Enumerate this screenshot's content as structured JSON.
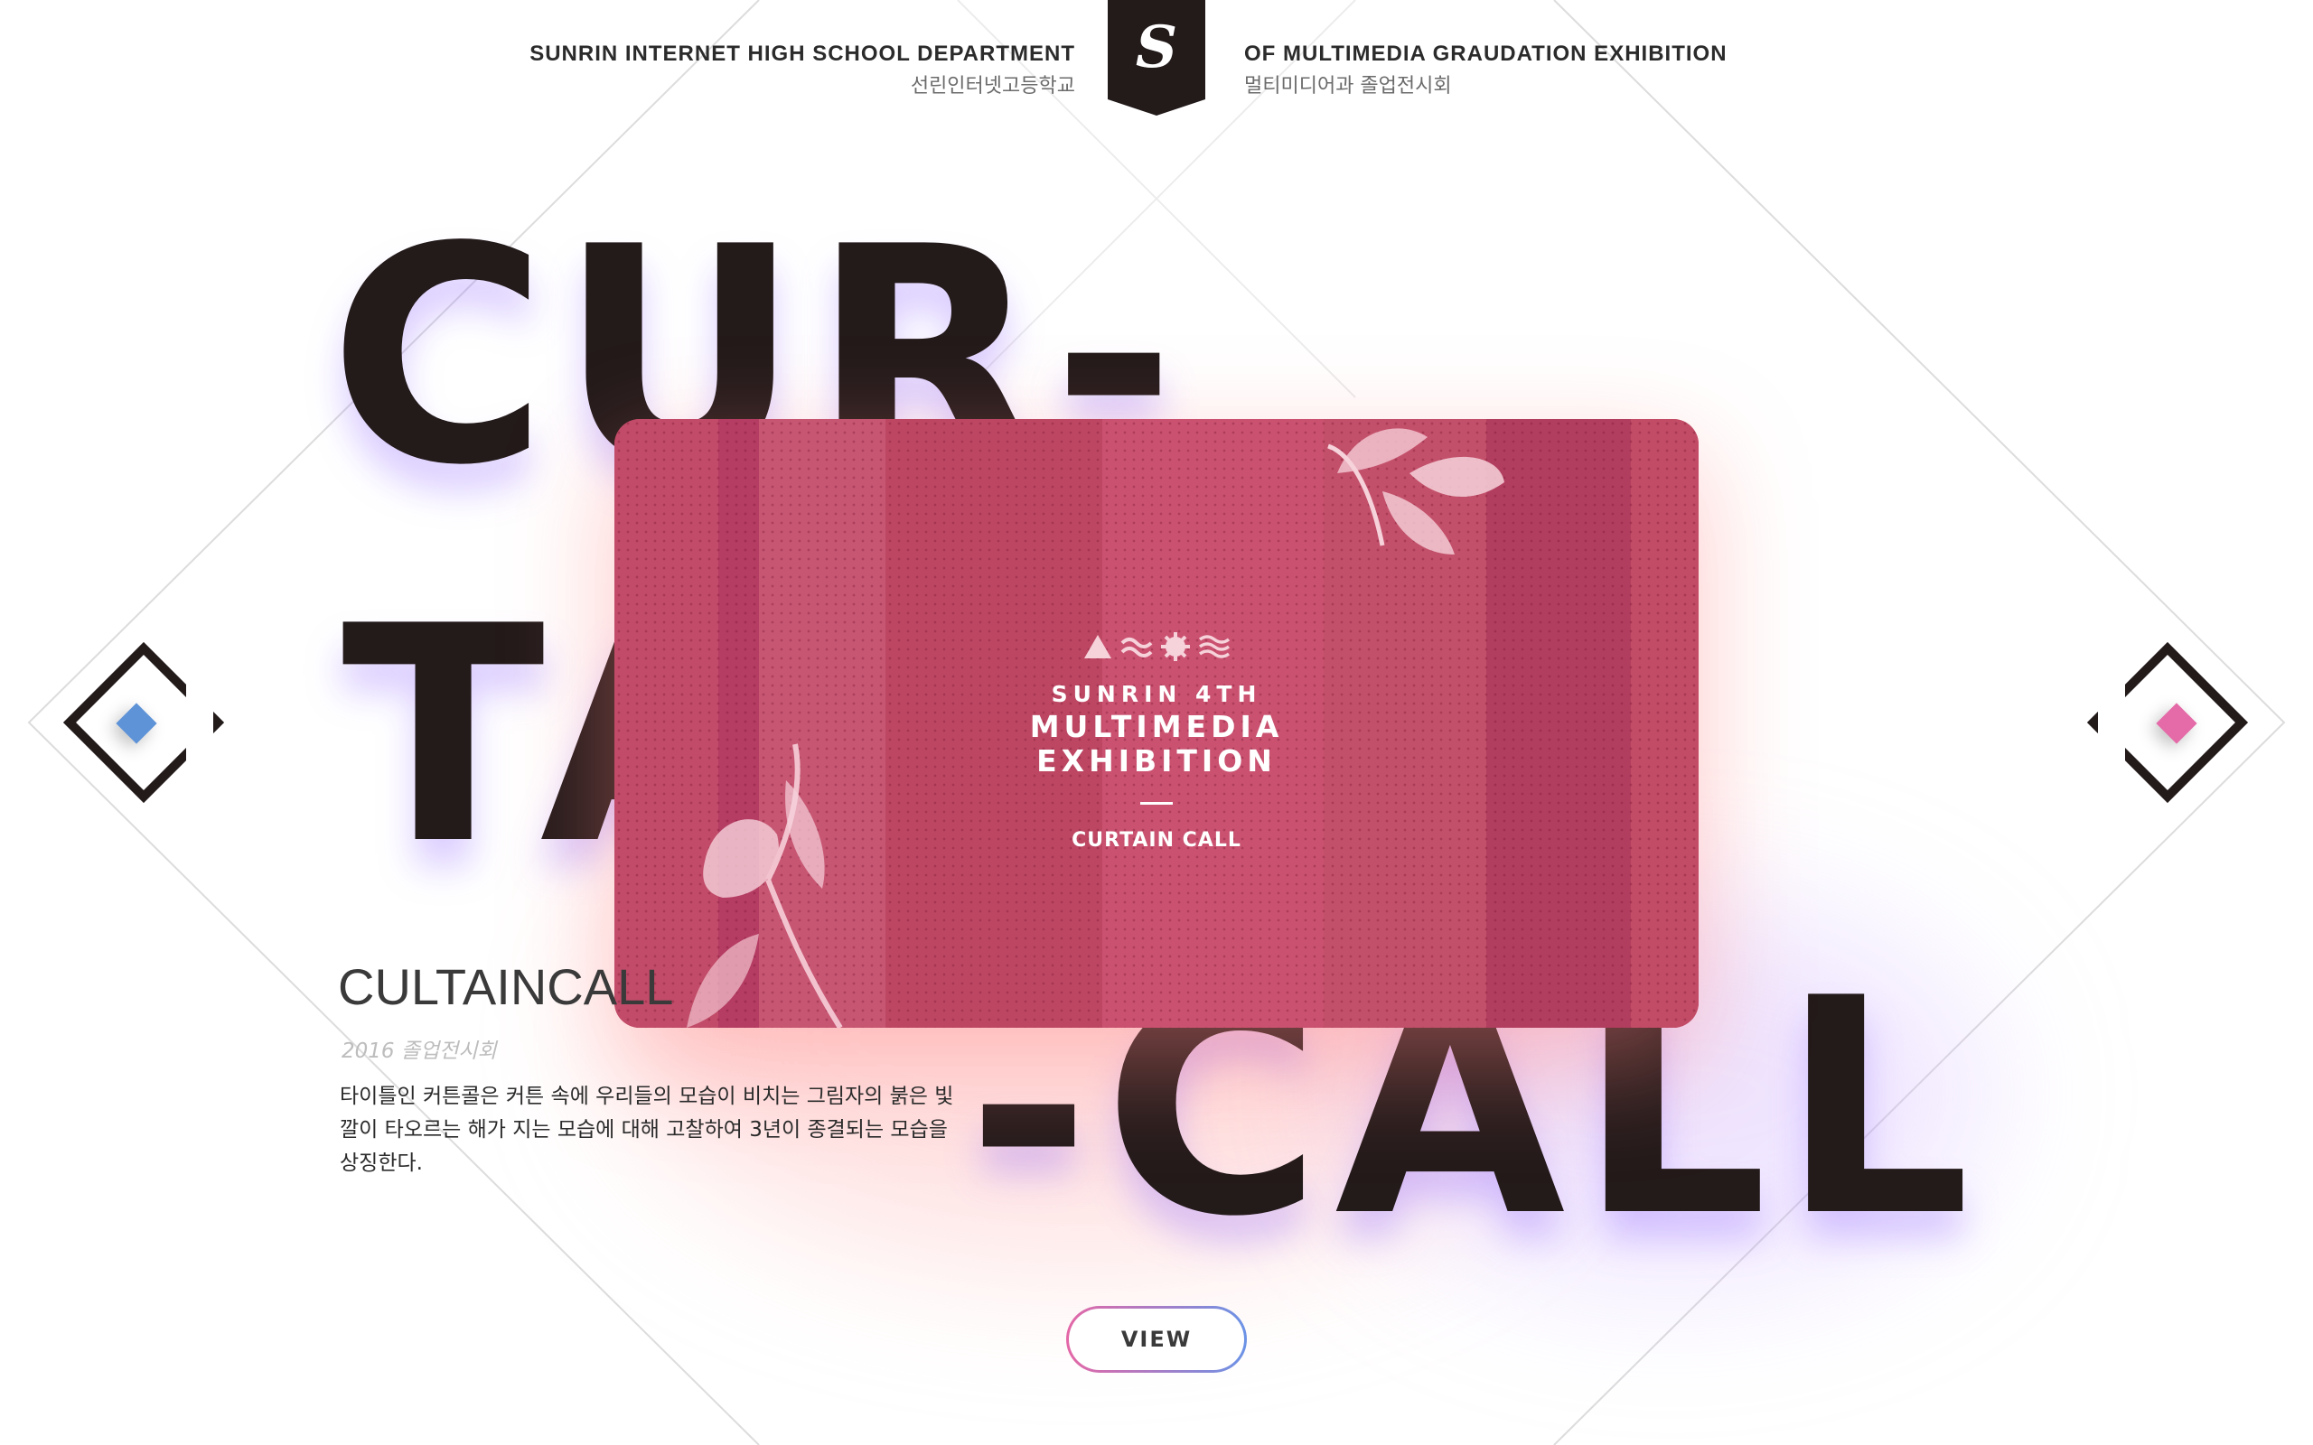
{
  "header": {
    "left_en": "SUNRIN INTERNET HIGH SCHOOL DEPARTMENT",
    "left_kr": "선린인터넷고등학교",
    "right_en": "OF MULTIMEDIA GRAUDATION EXHIBITION",
    "right_kr": "멀티미디어과 졸업전시회",
    "logo_glyph": "S"
  },
  "title": {
    "line1": "CUR-",
    "line2": "TAIN",
    "line3": "-CALL"
  },
  "card": {
    "line1": "SUNRIN 4TH",
    "line2": "MULTIMEDIA",
    "line3": "EXHIBITION",
    "line4": "CURTAIN CALL",
    "icons": [
      "triangle-icon",
      "wave-icon",
      "gear-icon",
      "ripple-icon"
    ]
  },
  "info": {
    "title": "CULTAINCALL",
    "subtitle": "2016  졸업전시회",
    "description": "타이틀인 커튼콜은 커튼 속에 우리들의 모습이 비치는 그림자의 붉은 빛깔이 타오르는 해가 지는 모습에 대해 고찰하여 3년이 종결되는 모습을 상징한다."
  },
  "button": {
    "label": "VIEW"
  },
  "colors": {
    "dark": "#231a1a",
    "card": "#c44a63",
    "prev_gem": "#5e93d8",
    "next_gem": "#e46aa8",
    "btn_from": "#e467a6",
    "btn_to": "#6b93e6"
  }
}
